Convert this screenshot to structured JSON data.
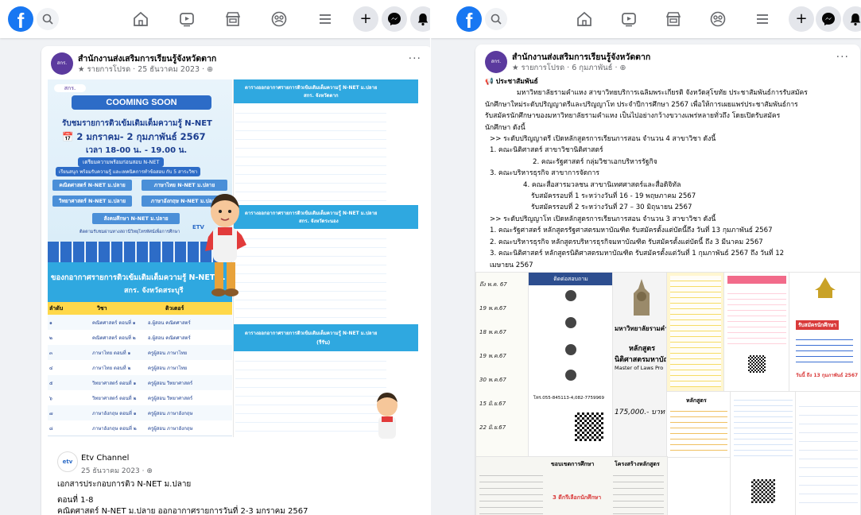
{
  "nav": {
    "logo": "f",
    "icons": [
      "search-icon",
      "home-icon",
      "video-icon",
      "marketplace-icon",
      "groups-icon",
      "menu-icon"
    ],
    "actions": [
      "create-icon",
      "messenger-icon",
      "notification-icon"
    ]
  },
  "left_post": {
    "page_name": "สำนักงานส่งเสริมการเรียนรู้จังหวัดตาก",
    "avatar_text": "สกร.",
    "meta": "★ รายการโปรด · 25 ธันวาคม 2023 · ⊕",
    "options": "···",
    "poster_main": {
      "logo": "สกร.",
      "banner": "COOMING SOON",
      "heading": "รับชมรายการติวเข้มเติมเต็มความรู้ N-NET",
      "dates": "2 มกราคม- 2 กุมภาพันธ์ 2567",
      "time": "เวลา 18-00 น. - 19.00 น.",
      "info_1": "เตรียมความพร้อมก่อนสอบ N-NET",
      "info_2": "เรียนสนุก พร้อมรับความรู้ และเทคนิคการทำข้อสอบ กับ 5 สาระวิชา",
      "subjects": [
        "คณิตศาสตร์ N-NET ม.ปลาย",
        "ภาษาไทย N-NET ม.ปลาย",
        "วิทยาศาสตร์ N-NET ม.ปลาย",
        "ภาษาอังกฤษ N-NET ม.ปลาย",
        "สังคมศึกษา N-NET ม.ปลาย"
      ],
      "footer": "ติดตามรับชมผ่านทางสถานีวิทยุโทรทัศน์เพื่อการศึกษา",
      "etv": "ETV"
    },
    "table_main": {
      "title": "ของกอากาศรายการติวเข้มเติมเต็มความรู้ N-NET ม.",
      "subtitle": "สกร. จังหวัดสระบุรี",
      "headers": [
        "ลำดับ",
        "วิชา",
        "ติวเตอร์"
      ],
      "rows": [
        [
          "๑",
          "คณิตศาสตร์ ตอนที่ ๑",
          "อ.ผู้สอน คณิตศาสตร์"
        ],
        [
          "๒",
          "คณิตศาสตร์ ตอนที่ ๒",
          "อ.ผู้สอน คณิตศาสตร์"
        ],
        [
          "๓",
          "ภาษาไทย ตอนที่ ๑",
          "ครูผู้สอน ภาษาไทย"
        ],
        [
          "๔",
          "ภาษาไทย ตอนที่ ๒",
          "ครูผู้สอน ภาษาไทย"
        ],
        [
          "๕",
          "วิทยาศาสตร์ ตอนที่ ๑",
          "ครูผู้สอน วิทยาศาสตร์"
        ],
        [
          "๖",
          "วิทยาศาสตร์ ตอนที่ ๒",
          "ครูผู้สอน วิทยาศาสตร์"
        ],
        [
          "๗",
          "ภาษาอังกฤษ ตอนที่ ๑",
          "ครูผู้สอน ภาษาอังกฤษ"
        ],
        [
          "๘",
          "ภาษาอังกฤษ ตอนที่ ๒",
          "ครูผู้สอน ภาษาอังกฤษ"
        ]
      ]
    },
    "side_tables": [
      {
        "title": "ตารางออกอากาศรายการติวเข้มเติมเต็มความรู้ N-NET ม.ปลาย",
        "subtitle": "สกร. จังหวัดตาก"
      },
      {
        "title": "ตารางออกอากาศรายการติวเข้มเติมเต็มความรู้ N-NET ม.ปลาย",
        "subtitle": "สกร. จังหวัดระนอง"
      },
      {
        "title": "ตารางออกอากาศรายการติวเข้มเติมเต็มความรู้ N-NET ม.ปลาย",
        "subtitle": "(รีรัน)"
      }
    ],
    "shared": {
      "name": "Etv Channel",
      "date": "25 ธันวาคม 2023 · ⊕",
      "text_1": "เอกสารประกอบการติว N-NET ม.ปลาย",
      "text_2": "ตอนที่ 1-8",
      "text_3": "คณิตศาสตร์ N-NET ม.ปลาย ออกอากาศรายการวันที่ 2-3 มกราคม 2567"
    }
  },
  "right_post": {
    "page_name": "สำนักงานส่งเสริมการเรียนรู้จังหวัดตาก",
    "avatar_text": "สกร.",
    "meta": "★ รายการโปรด · 6 กุมภาพันธ์ · ⊕",
    "options": "···",
    "lines": [
      "📢 ประชาสัมพันธ์",
      "มหาวิทยาลัยรามคำแหง สาขาวิทยบริการเฉลิมพระเกียรติ จังหวัดสุโขทัย ประชาสัมพันธ์การรับสมัคร",
      "นักศึกษาใหม่ระดับปริญญาตรีและปริญญาโท ประจำปีการศึกษา 2567 เพื่อให้การเผยแพร่ประชาสัมพันธ์การ",
      "รับสมัครนักศึกษาของมหาวิทยาลัยรามคำแหง เป็นไปอย่างกว้างขวางแพร่หลายทั่วถึง  โดยเปิดรับสมัคร",
      "นักศึกษา ดังนี้",
      ">> ระดับปริญญาตรี เปิดหลักสูตรการเรียนการสอน จำนวน 4 สาขาวิชา ดังนี้",
      "1. คณะนิติศาสตร์ สาขาวิชานิติศาสตร์",
      "2. คณะรัฐศาสตร์ กลุ่มวิชาเอกบริหารรัฐกิจ",
      "3. คณะบริหารธุรกิจ สาขาการจัดการ",
      "4. คณะสื่อสารมวลชน สาขานิเทศศาสตร์และสื่อดิจิทัล",
      "รับสมัครรอบที่ 1 ระหว่างวันที่ 16 - 19 พฤษภาคม 2567",
      "รับสมัครรอบที่ 2 ระหว่างวันที่ 27 – 30 มิถุนายน 2567",
      ">> ระดับปริญญาโท เปิดหลักสูตรการเรียนการสอน จำนวน 3 สาขาวิชา ดังนี้",
      "1. คณะรัฐศาสตร์ หลักสูตรรัฐศาสตรมหาบัณฑิต รับสมัครตั้งแต่บัดนี้ถึง วันที่ 13 กุมภาพันธ์ 2567",
      "2. คณะบริหารธุรกิจ หลักสูตรบริหารธุรกิจมหาบัณฑิต รับสมัครตั้งแต่บัดนี้ ถึง 3 มีนาคม 2567",
      "3. คณะนิติศาสตร์ หลักสูตรนิติศาสตรมหาบัณฑิต รับสมัครตั้งแต่วันที่ 1 กุมภาพันธ์ 2567 ถึง วันที่ 12",
      "เมษายน 2567"
    ],
    "brochures": {
      "b1_dates": [
        "ถึง พ.ค. 67",
        "19 พ.ค.67",
        "18 พ.ค.67",
        "19 พ.ค.67",
        "30 พ.ค.67",
        "15 มิ.ย.67",
        "22 มิ.ย.67"
      ],
      "b2_title": "ติดต่อสอบถาม",
      "b2_phone": "โทร.055-845113-4,082-7759969",
      "b3_title": "มหาวิทยาลัยรามคำแหง",
      "b3_sub": "หลักสูตร",
      "b3_sub2": "นิติศาสตรมหาบัณฑิต",
      "b3_eng": "Master of Laws Pro",
      "b3_fee": "175,000.- บาท",
      "b4_title": "หลักสูตร",
      "b6_title": "รับสมัครนักศึกษา",
      "b6_date": "วันนี้ ถึง 13 กุมภาพันธ์ 2567",
      "b7_title": "ขอบเขตการศึกษา",
      "b7_sub": "3 ดีกรีเลือกนักศึกษา",
      "b8_title": "โครงสร้างหลักสูตร"
    }
  }
}
